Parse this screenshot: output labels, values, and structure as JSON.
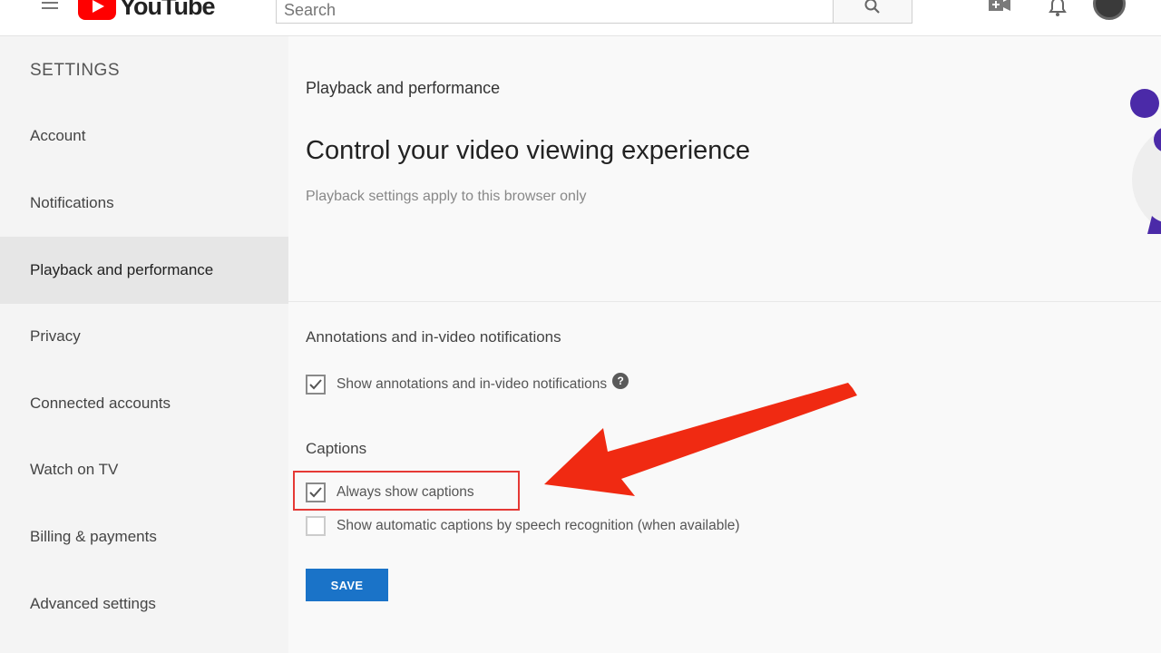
{
  "topbar": {
    "logo_text": "YouTube",
    "search_placeholder": "Search"
  },
  "sidebar": {
    "title": "SETTINGS",
    "items": [
      {
        "label": "Account"
      },
      {
        "label": "Notifications"
      },
      {
        "label": "Playback and performance",
        "active": true
      },
      {
        "label": "Privacy"
      },
      {
        "label": "Connected accounts"
      },
      {
        "label": "Watch on TV"
      },
      {
        "label": "Billing & payments"
      },
      {
        "label": "Advanced settings"
      }
    ]
  },
  "main": {
    "section_label": "Playback and performance",
    "headline": "Control your video viewing experience",
    "subline": "Playback settings apply to this browser only",
    "annotations": {
      "title": "Annotations and in-video notifications",
      "option": {
        "label": "Show annotations and in-video notifications",
        "checked": true
      }
    },
    "captions": {
      "title": "Captions",
      "options": [
        {
          "label": "Always show captions",
          "checked": true
        },
        {
          "label": "Show automatic captions by speech recognition (when available)",
          "checked": false
        }
      ]
    },
    "save_label": "SAVE"
  },
  "colors": {
    "brand_red": "#ff0000",
    "save_blue": "#1a73c8",
    "highlight_red": "#e53935",
    "arrow_red": "#f02a12"
  }
}
